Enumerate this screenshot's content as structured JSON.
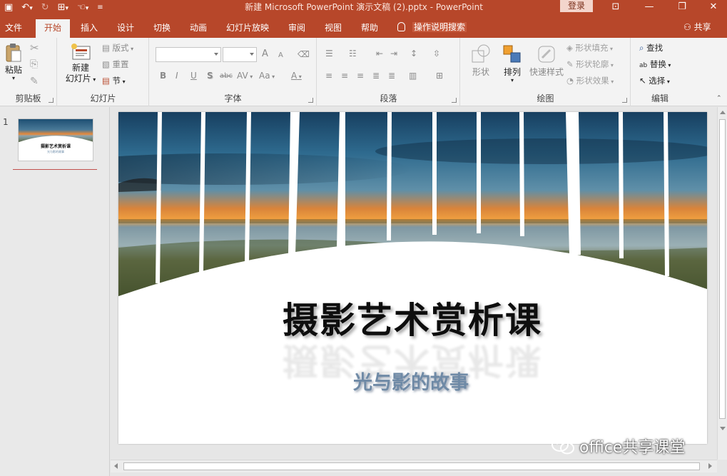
{
  "titlebar": {
    "document_title": "新建 Microsoft PowerPoint 演示文稿 (2).pptx  -  PowerPoint",
    "login_label": "登录",
    "qat_icons": [
      "save-icon",
      "undo-icon",
      "redo-icon",
      "start-from-beginning-icon",
      "touch-mode-icon",
      "customize-qat-icon"
    ],
    "window_controls": [
      "ribbon-display-options-icon",
      "minimize-icon",
      "restore-icon",
      "close-icon"
    ],
    "glyphs": {
      "save": "▣",
      "undo": "↶",
      "undo_drop": "▾",
      "redo": "↻",
      "present": "⊞",
      "present_drop": "▾",
      "touch": "☜",
      "touch_drop": "▾",
      "customize": "≡",
      "ribbon_opts": "⊡",
      "minimize": "—",
      "restore": "❐",
      "close": "✕"
    }
  },
  "tabs": [
    {
      "label": "文件",
      "active": false
    },
    {
      "label": "开始",
      "active": true
    },
    {
      "label": "插入",
      "active": false
    },
    {
      "label": "设计",
      "active": false
    },
    {
      "label": "切换",
      "active": false
    },
    {
      "label": "动画",
      "active": false
    },
    {
      "label": "幻灯片放映",
      "active": false
    },
    {
      "label": "审阅",
      "active": false
    },
    {
      "label": "视图",
      "active": false
    },
    {
      "label": "帮助",
      "active": false
    }
  ],
  "tell_me": "操作说明搜索",
  "share": "共享",
  "share_glyph": "⚇",
  "ribbon": {
    "clipboard": {
      "label": "剪贴板",
      "paste": "粘贴",
      "cut_glyph": "✂",
      "copy_glyph": "⎘",
      "brush_glyph": "✎"
    },
    "slides": {
      "label": "幻灯片",
      "new_slide_line1": "新建",
      "new_slide_line2": "幻灯片",
      "layout": "版式",
      "reset": "重置",
      "section": "节"
    },
    "font": {
      "label": "字体",
      "font_name_value": "",
      "font_size_value": "",
      "grow_glyph": "A",
      "shrink_glyph": "A",
      "clear_glyph": "⌫",
      "bold": "B",
      "italic": "I",
      "underline": "U",
      "shadow": "S",
      "strike": "abc",
      "spacing": "AV",
      "case": "Aa",
      "color": "A"
    },
    "paragraph": {
      "label": "段落",
      "row1_glyphs": [
        "☰",
        "☷",
        "⇤",
        "⇥",
        "↕",
        "⇳"
      ],
      "row2_glyphs": [
        "≡",
        "≡",
        "≡",
        "≣",
        "≣",
        "▥",
        "⊞"
      ]
    },
    "drawing": {
      "label": "绘图",
      "shapes": "形状",
      "arrange": "排列",
      "quick_styles": "快速样式",
      "shape_fill": "形状填充",
      "shape_outline": "形状轮廓",
      "shape_effects": "形状效果"
    },
    "editing": {
      "label": "编辑",
      "find": "查找",
      "replace": "替换",
      "select": "选择",
      "find_glyph": "⌕",
      "replace_glyph": "ab",
      "select_glyph": "↖"
    }
  },
  "thumbnail": {
    "number": "1",
    "title": "摄影艺术赏析课",
    "subtitle": "光与影的故事"
  },
  "slide": {
    "title": "摄影艺术赏析课",
    "subtitle": "光与影的故事"
  },
  "watermark": "office共享课堂",
  "colors": {
    "brand": "#b7472a",
    "subtitle": "#6f8aa6",
    "sky_top": "#1e4f73",
    "sunset": "#e8893a",
    "sea": "#8aa3ae",
    "moss": "#55613a"
  }
}
